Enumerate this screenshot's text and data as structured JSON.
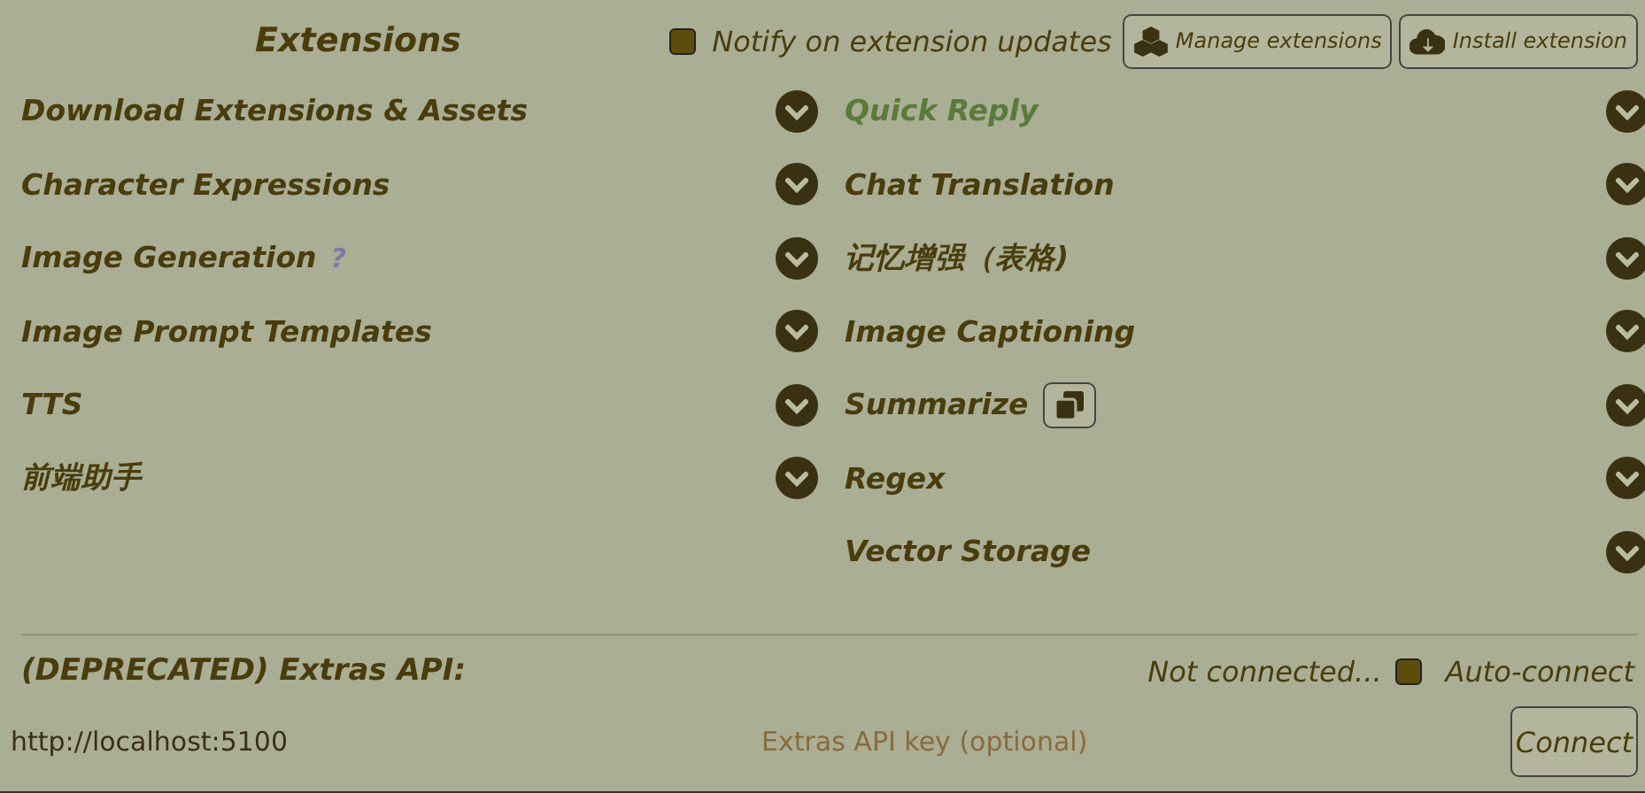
{
  "header": {
    "title": "Extensions",
    "notify": {
      "label": "Notify on extension updates",
      "checked": false
    },
    "buttons": [
      {
        "label": "Manage extensions",
        "kind": "manage"
      },
      {
        "label": "Install extension",
        "kind": "install"
      }
    ]
  },
  "columns": [
    [
      {
        "title": "Download Extensions & Assets",
        "highlighted": false,
        "expanded": false
      },
      {
        "title": "Character Expressions",
        "highlighted": false,
        "expanded": false
      },
      {
        "title": "Image Generation",
        "help": "?",
        "highlighted": false,
        "expanded": false
      },
      {
        "title": "Image Prompt Templates",
        "highlighted": false,
        "expanded": false
      },
      {
        "title": "TTS",
        "highlighted": false,
        "expanded": false
      },
      {
        "title": "前端助手",
        "highlighted": false,
        "expanded": false
      }
    ],
    [
      {
        "title": "Quick Reply",
        "highlighted": true,
        "expanded": false
      },
      {
        "title": "Chat Translation",
        "highlighted": false,
        "expanded": false
      },
      {
        "title": "记忆增强（表格)",
        "highlighted": false,
        "expanded": false
      },
      {
        "title": "Image Captioning",
        "highlighted": false,
        "expanded": false
      },
      {
        "title": "Summarize",
        "popout": true,
        "highlighted": false,
        "expanded": false
      },
      {
        "title": "Regex",
        "highlighted": false,
        "expanded": false
      },
      {
        "title": "Vector Storage",
        "highlighted": false,
        "expanded": false
      }
    ]
  ],
  "extras": {
    "title": "(DEPRECATED) Extras API:",
    "status": "Not connected...",
    "auto_connect": {
      "label": "Auto-connect",
      "checked": false
    },
    "url": {
      "value": "http://localhost:5100"
    },
    "key": {
      "placeholder": "Extras API key (optional)"
    },
    "connect_button": "Connect"
  }
}
